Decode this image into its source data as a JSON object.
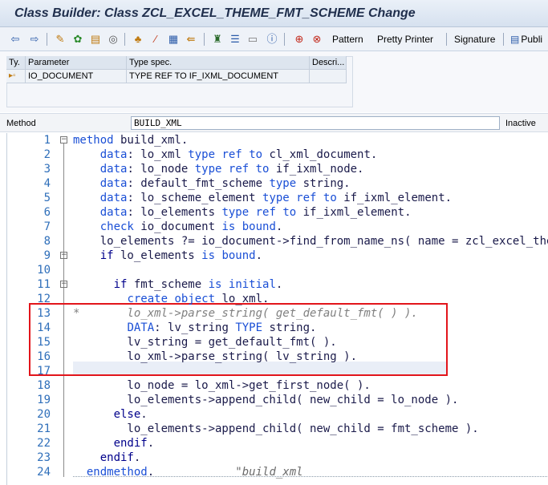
{
  "window": {
    "title": "Class Builder: Class ZCL_EXCEL_THEME_FMT_SCHEME Change"
  },
  "toolbar": {
    "icons": [
      "back-icon",
      "forward-icon",
      "other-object-icon",
      "display-change-icon",
      "active-inactive-icon",
      "display-object-list-icon",
      "check-icon",
      "activate-icon",
      "test-icon",
      "where-used-icon",
      "navigation-window-icon",
      "enhance-icon",
      "class-info-icon",
      "overview-icon",
      "insert-statement-icon",
      "delete-icon"
    ],
    "pattern_label": "Pattern",
    "pretty_printer_label": "Pretty Printer",
    "signature_label": "Signature",
    "public_label": "Publi"
  },
  "param_table": {
    "headers": [
      "Ty.",
      "Parameter",
      "Type spec.",
      "Descri..."
    ],
    "rows": [
      {
        "type_icon": "importing-icon",
        "parameter": "IO_DOCUMENT",
        "type_spec": "TYPE REF TO IF_IXML_DOCUMENT",
        "description": ""
      }
    ]
  },
  "method_bar": {
    "label": "Method",
    "method_name": "BUILD_XML",
    "status": "Inactive"
  },
  "editor": {
    "lines": [
      {
        "n": "1",
        "text": "method build_xml."
      },
      {
        "n": "2",
        "text": "    data: lo_xml type ref to cl_xml_document."
      },
      {
        "n": "3",
        "text": "    data: lo_node type ref to if_ixml_node."
      },
      {
        "n": "4",
        "text": "    data: default_fmt_scheme type string."
      },
      {
        "n": "5",
        "text": "    data: lo_scheme_element type ref to if_ixml_element."
      },
      {
        "n": "6",
        "text": "    data: lo_elements type ref to if_ixml_element."
      },
      {
        "n": "7",
        "text": "    check io_document is bound."
      },
      {
        "n": "8",
        "text": "    lo_elements ?= io_document->find_from_name_ns( name = zcl_excel_the"
      },
      {
        "n": "9",
        "text": "    if lo_elements is bound."
      },
      {
        "n": "10",
        "text": ""
      },
      {
        "n": "11",
        "text": "      if fmt_scheme is initial."
      },
      {
        "n": "12",
        "text": "        create object lo_xml."
      },
      {
        "n": "13",
        "text": "*       lo_xml->parse_string( get_default_fmt( ) )."
      },
      {
        "n": "14",
        "text": "        DATA: lv_string TYPE string."
      },
      {
        "n": "15",
        "text": "        lv_string = get_default_fmt( )."
      },
      {
        "n": "16",
        "text": "        lo_xml->parse_string( lv_string )."
      },
      {
        "n": "17",
        "text": ""
      },
      {
        "n": "18",
        "text": "        lo_node = lo_xml->get_first_node( )."
      },
      {
        "n": "19",
        "text": "        lo_elements->append_child( new_child = lo_node )."
      },
      {
        "n": "20",
        "text": "      else."
      },
      {
        "n": "21",
        "text": "        lo_elements->append_child( new_child = fmt_scheme )."
      },
      {
        "n": "22",
        "text": "      endif."
      },
      {
        "n": "23",
        "text": "    endif."
      },
      {
        "n": "24",
        "text": "  endmethod.            \"build_xml"
      }
    ]
  },
  "colors": {
    "keyword": "#1a4fd6",
    "line_number": "#2f6fba",
    "comment": "#808080",
    "highlight_box": "#e2151b"
  }
}
